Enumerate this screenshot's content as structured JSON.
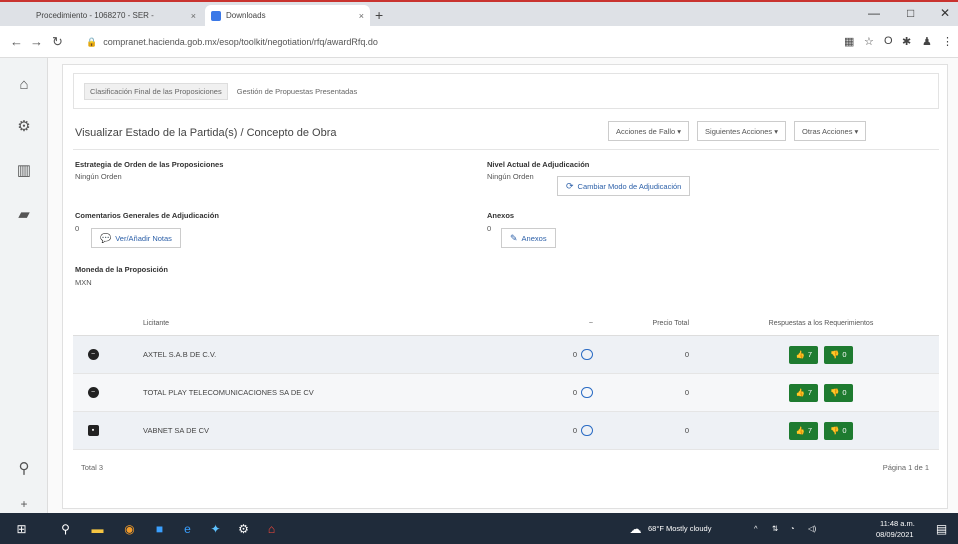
{
  "browser": {
    "tabs": [
      {
        "label": "Procedimiento - 1068270 - SER -",
        "active": false
      },
      {
        "label": "Downloads",
        "active": true
      }
    ],
    "url": "compranet.hacienda.gob.mx/esop/toolkit/negotiation/rfq/awardRfq.do",
    "window_controls": [
      "—",
      "□",
      "✕"
    ]
  },
  "rail": {
    "icons": [
      "home-icon",
      "settings-icon",
      "building-icon",
      "document-icon",
      "search-icon",
      "plus-icon"
    ]
  },
  "breadcrumbs": [
    {
      "label": "Clasificación Final de las Proposiciones",
      "active": true
    },
    {
      "label": "Gestión de Propuestas Presentadas",
      "active": false
    }
  ],
  "page": {
    "title": "Visualizar Estado de la Partida(s) / Concepto de Obra",
    "actions": [
      "Acciones de Fallo ▾",
      "Siguientes Acciones ▾",
      "Otras Acciones ▾"
    ]
  },
  "fields": {
    "estrategia_label": "Estrategia de Orden de las Proposiciones",
    "estrategia_value": "Ningún Orden",
    "nivel_label": "Nivel Actual de Adjudicación",
    "nivel_value": "Ningún Orden",
    "cambiar_label": "Cambiar Modo de Adjudicación",
    "comentarios_label": "Comentarios Generales de Adjudicación",
    "comentarios_count": "0",
    "notas_label": "Ver/Añadir Notas",
    "anexos_label": "Anexos",
    "anexos_count": "0",
    "anexos_btn": "Anexos",
    "moneda_label": "Moneda de la Proposición",
    "moneda_value": "MXN"
  },
  "table": {
    "headers": {
      "licitante": "Licitante",
      "count": "~",
      "precio": "Precio Total",
      "respuestas": "Respuestas a los Requerimientos"
    },
    "rows": [
      {
        "name": "AXTEL S.A.B DE C.V.",
        "count": "0",
        "price": "0",
        "ok": "7",
        "nok": "0"
      },
      {
        "name": "TOTAL PLAY TELECOMUNICACIONES SA DE CV",
        "count": "0",
        "price": "0",
        "ok": "7",
        "nok": "0"
      },
      {
        "name": "VABNET SA DE CV",
        "count": "0",
        "price": "0",
        "ok": "7",
        "nok": "0"
      }
    ],
    "footer_total": "Total 3",
    "footer_page": "Página 1 de 1"
  },
  "taskbar": {
    "weather": "68°F Mostly cloudy",
    "time": "11:48 a.m.",
    "date": "08/09/2021"
  },
  "colors": {
    "accent_green": "#1e7b30",
    "link_blue": "#2b5fa8"
  }
}
